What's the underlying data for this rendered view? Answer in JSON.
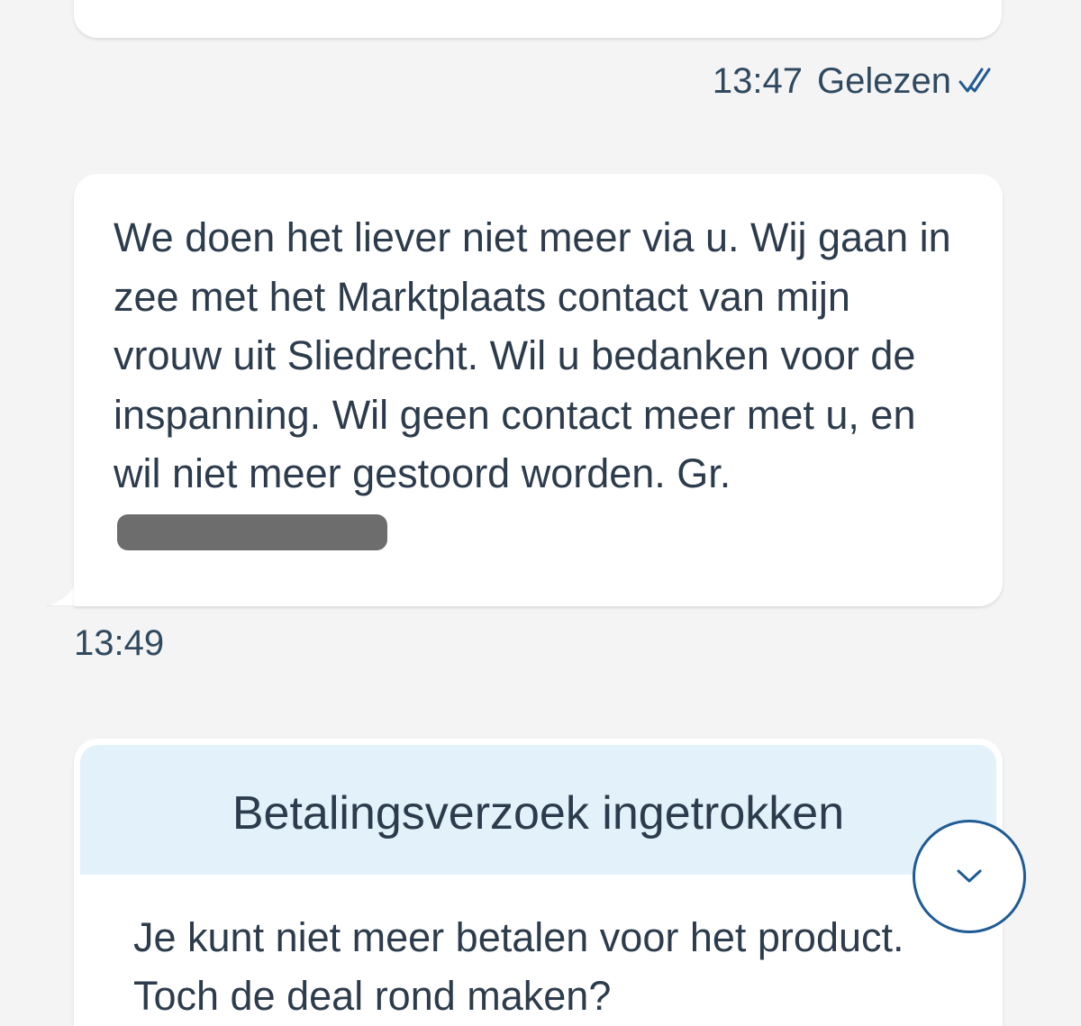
{
  "previous_message": {
    "time": "13:47",
    "status": "Gelezen",
    "status_icon": "double-check-icon",
    "status_icon_color": "#1f5b95"
  },
  "incoming_message": {
    "text": "We doen het liever niet meer via u. Wij gaan in zee met het Marktplaats contact van mijn vrouw uit Sliedrecht. Wil u bedanken voor de inspanning. Wil geen contact meer met u, en wil niet meer gestoord worden. Gr. ",
    "time": "13:49"
  },
  "payment_card": {
    "title": "Betalingsverzoek ingetrokken",
    "body": "Je kunt niet meer betalen voor het product. Toch de deal rond maken?",
    "header_color": "#e2f1fa"
  },
  "scroll_button": {
    "icon": "chevron-down-icon",
    "color": "#1f5b95"
  }
}
